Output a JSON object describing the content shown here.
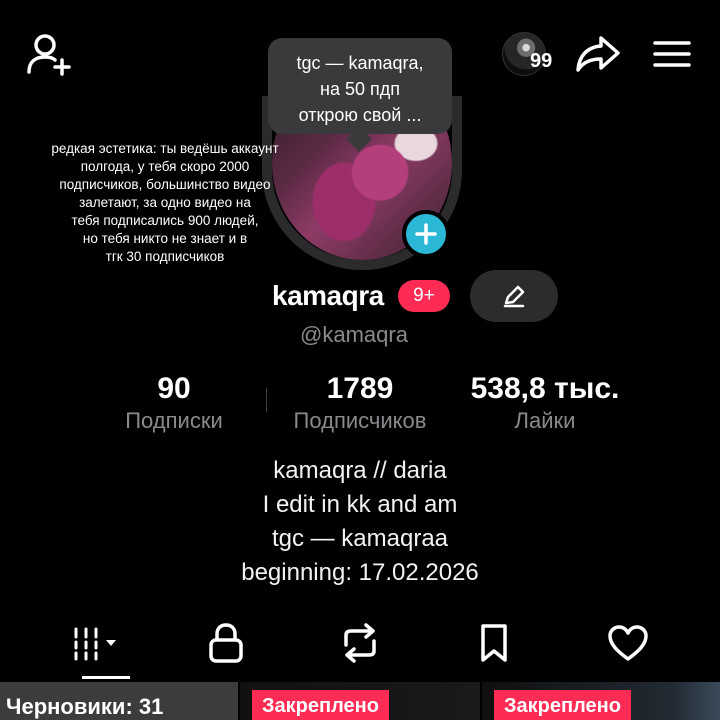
{
  "header": {
    "story_count": "99"
  },
  "tooltip": {
    "lines": [
      "tgc — kamaqra,",
      "на 50 пдп",
      "открою свой ..."
    ]
  },
  "caption": {
    "lines": [
      "редкая эстетика: ты ведёшь аккаунт",
      "полгода, у тебя скоро 2000",
      "подписчиков, большинство видео",
      "залетают, за одно видео на",
      "тебя подписались 900 людей,",
      "но тебя никто не знает и в",
      "тгк 30 подписчиков"
    ]
  },
  "profile": {
    "username": "kamaqra",
    "notifications_badge": "9+",
    "handle": "@kamaqra"
  },
  "stats": {
    "following": {
      "value": "90",
      "label": "Подписки"
    },
    "followers": {
      "value": "1789",
      "label": "Подписчиков"
    },
    "likes": {
      "value": "538,8 тыс.",
      "label": "Лайки"
    }
  },
  "bio": {
    "lines": [
      "kamaqra // daria",
      "I edit in kk and am",
      "tgc — kamaqraa",
      "beginning: 17.02.2026"
    ]
  },
  "tabs": [
    {
      "name": "videos-grid",
      "icon": "grid-icon",
      "active": true
    },
    {
      "name": "private",
      "icon": "lock-icon",
      "active": false
    },
    {
      "name": "reposts",
      "icon": "repost-icon",
      "active": false
    },
    {
      "name": "saved",
      "icon": "bookmark-icon",
      "active": false
    },
    {
      "name": "liked",
      "icon": "heart-icon",
      "active": false
    }
  ],
  "videos": {
    "drafts_label": "Черновики: 31",
    "pinned_label": "Закреплено",
    "pinned_label_2": "Закреплено"
  },
  "colors": {
    "accent": "#fe2c55",
    "plus_badge": "#2bb7d6",
    "background": "#000000",
    "muted_text": "#8a8a8e"
  }
}
